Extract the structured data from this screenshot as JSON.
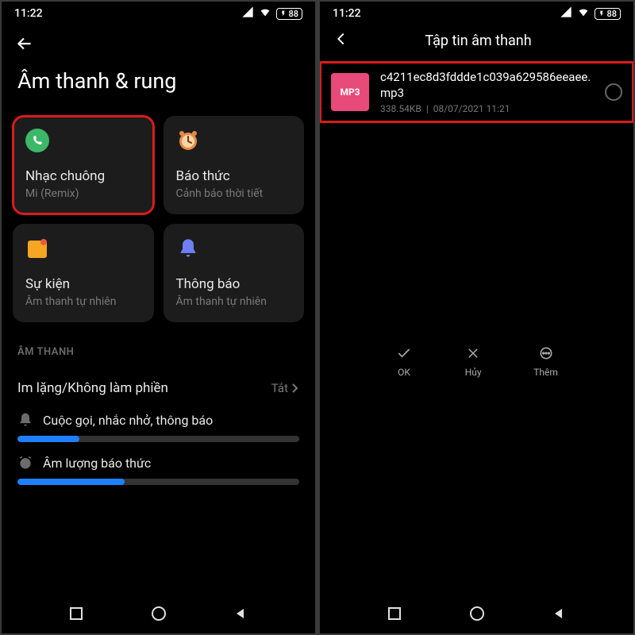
{
  "status": {
    "time": "11:22",
    "battery": "88"
  },
  "left": {
    "title": "Âm thanh & rung",
    "tiles": {
      "ringtone": {
        "title": "Nhạc chuông",
        "sub": "Mi (Remix)"
      },
      "alarm": {
        "title": "Báo thức",
        "sub": "Cảnh báo thời tiết"
      },
      "events": {
        "title": "Sự kiện",
        "sub": "Âm thanh tự nhiên"
      },
      "notif": {
        "title": "Thông báo",
        "sub": "Âm thanh tự nhiên"
      }
    },
    "section_label": "ÂM THANH",
    "dnd": {
      "label": "Im lặng/Không làm phiền",
      "value": "Tắt"
    },
    "slider1": {
      "label": "Cuộc gọi, nhắc nhở, thông báo",
      "percent": 22
    },
    "slider2": {
      "label": "Âm lượng báo thức",
      "percent": 38
    }
  },
  "right": {
    "title": "Tập tin âm thanh",
    "file": {
      "badge": "MP3",
      "name": "c4211ec8d3fddde1c039a629586eeaee.mp3",
      "size": "338.54KB",
      "date": "08/07/2021 11:21"
    },
    "actions": {
      "ok": "OK",
      "cancel": "Hủy",
      "more": "Thêm"
    }
  }
}
